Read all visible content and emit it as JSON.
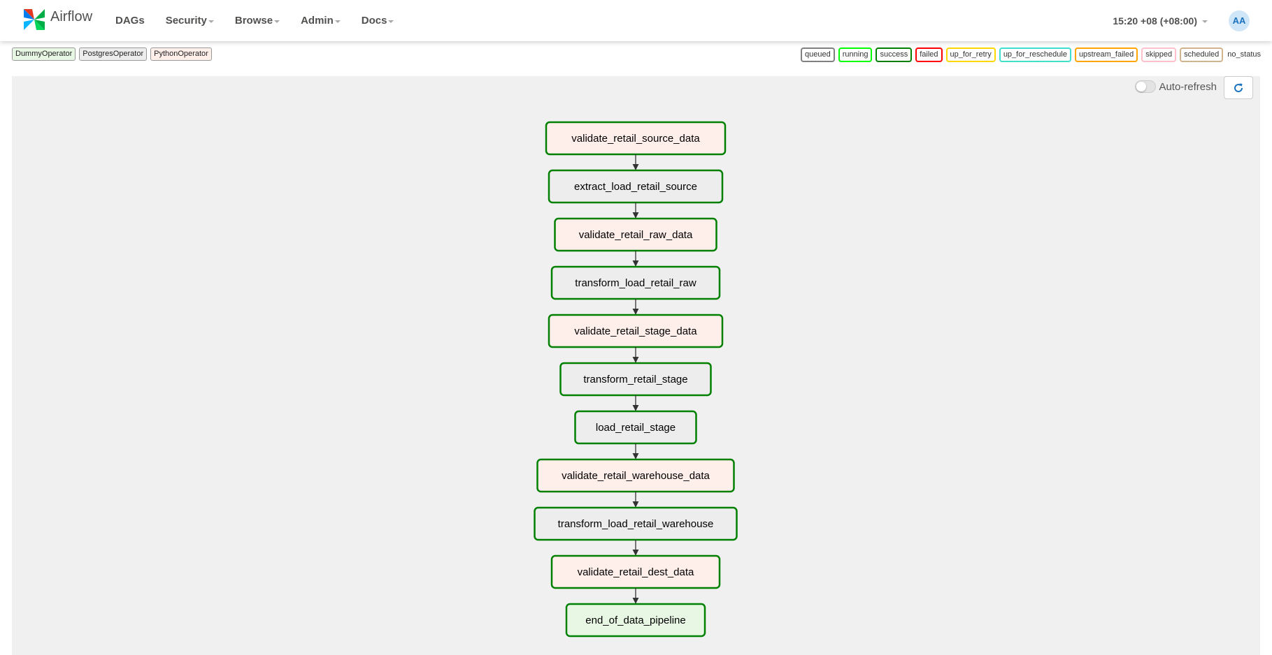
{
  "navbar": {
    "brand": "Airflow",
    "menu": [
      {
        "label": "DAGs",
        "dropdown": false
      },
      {
        "label": "Security",
        "dropdown": true
      },
      {
        "label": "Browse",
        "dropdown": true
      },
      {
        "label": "Admin",
        "dropdown": true
      },
      {
        "label": "Docs",
        "dropdown": true
      }
    ],
    "clock": "15:20 +08 (+08:00)",
    "user_initials": "AA"
  },
  "operators": [
    {
      "label": "DummyOperator",
      "color": "#e8f7e4"
    },
    {
      "label": "PostgresOperator",
      "color": "#ededed"
    },
    {
      "label": "PythonOperator",
      "color": "#ffefeb"
    }
  ],
  "states": [
    {
      "label": "queued",
      "color": "#808080"
    },
    {
      "label": "running",
      "color": "#00ff00"
    },
    {
      "label": "success",
      "color": "#008000"
    },
    {
      "label": "failed",
      "color": "#ff0000"
    },
    {
      "label": "up_for_retry",
      "color": "#ffd700"
    },
    {
      "label": "up_for_reschedule",
      "color": "#40e0d0"
    },
    {
      "label": "upstream_failed",
      "color": "#ffa500"
    },
    {
      "label": "skipped",
      "color": "#ffc0cb"
    },
    {
      "label": "scheduled",
      "color": "#d2b48c"
    }
  ],
  "no_status_label": "no_status",
  "graph": {
    "autorefresh_label": "Auto-refresh",
    "nodes": [
      {
        "id": "validate_retail_source_data",
        "operator": "PythonOperator",
        "state": "success"
      },
      {
        "id": "extract_load_retail_source",
        "operator": "PostgresOperator",
        "state": "success"
      },
      {
        "id": "validate_retail_raw_data",
        "operator": "PythonOperator",
        "state": "success"
      },
      {
        "id": "transform_load_retail_raw",
        "operator": "PostgresOperator",
        "state": "success"
      },
      {
        "id": "validate_retail_stage_data",
        "operator": "PythonOperator",
        "state": "success"
      },
      {
        "id": "transform_retail_stage",
        "operator": "PostgresOperator",
        "state": "success"
      },
      {
        "id": "load_retail_stage",
        "operator": "PostgresOperator",
        "state": "success"
      },
      {
        "id": "validate_retail_warehouse_data",
        "operator": "PythonOperator",
        "state": "success"
      },
      {
        "id": "transform_load_retail_warehouse",
        "operator": "PostgresOperator",
        "state": "success"
      },
      {
        "id": "validate_retail_dest_data",
        "operator": "PythonOperator",
        "state": "success"
      },
      {
        "id": "end_of_data_pipeline",
        "operator": "DummyOperator",
        "state": "success"
      }
    ]
  }
}
